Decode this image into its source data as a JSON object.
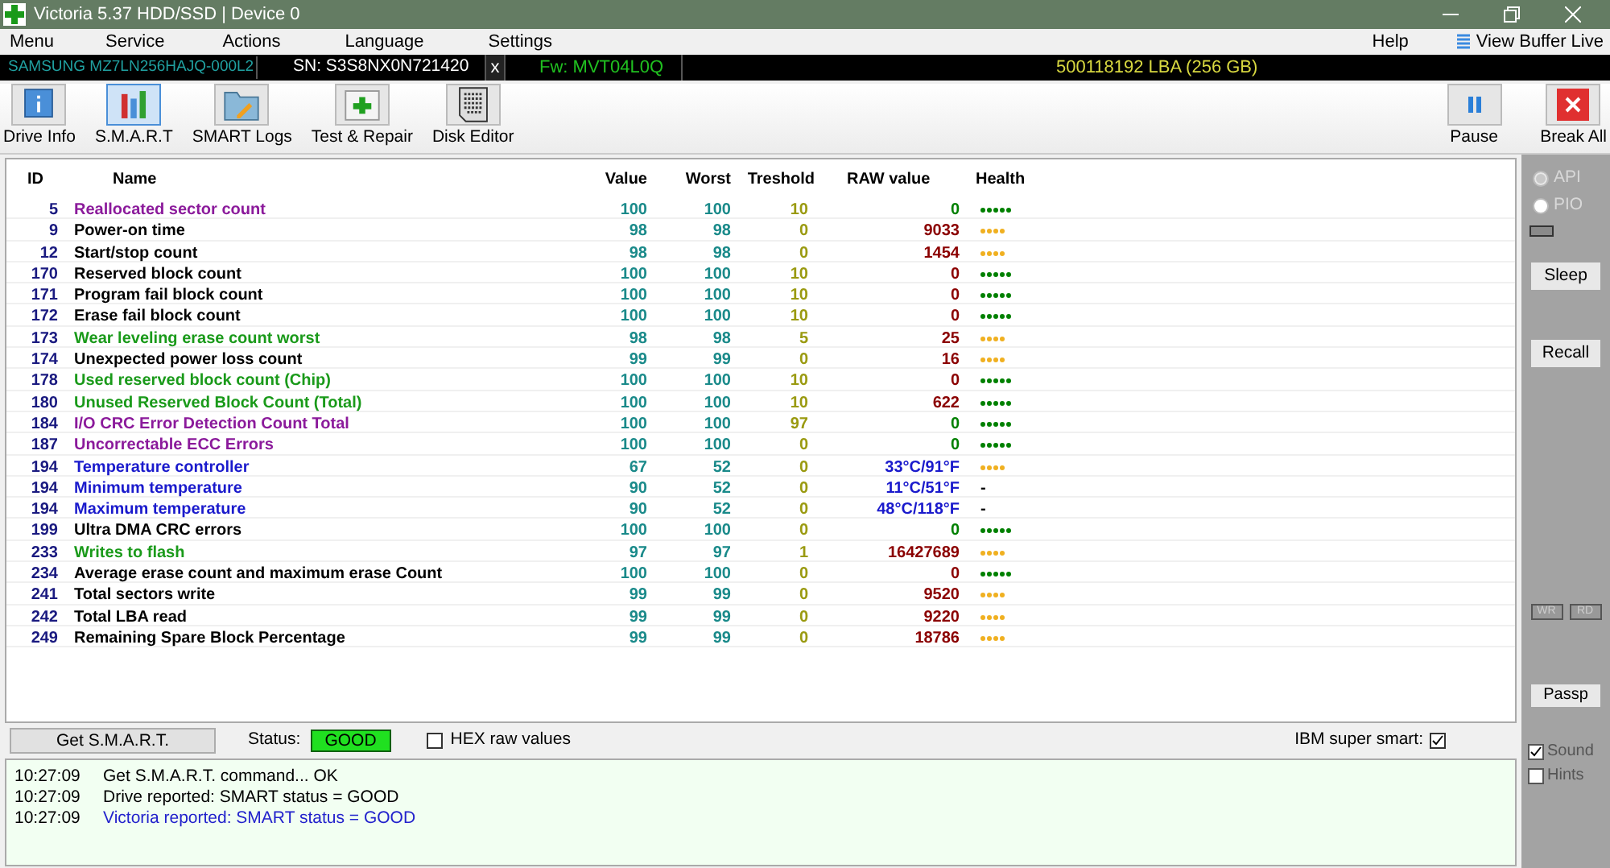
{
  "window": {
    "title": "Victoria 5.37 HDD/SSD | Device 0"
  },
  "menu": [
    {
      "label": "Menu"
    },
    {
      "label": "Service"
    },
    {
      "label": "Actions"
    },
    {
      "label": "Language"
    },
    {
      "label": "Settings"
    }
  ],
  "menu_right": {
    "help": "Help",
    "view_buffer": "View Buffer Live"
  },
  "device_bar": {
    "model": "SAMSUNG MZ7LN256HAJQ-000L2",
    "serial": "SN: S3S8NX0N721420",
    "close": "x",
    "firmware": "Fw: MVT04L0Q",
    "capacity": "500118192 LBA (256 GB)"
  },
  "toolbar": [
    {
      "label": "Drive Info",
      "kind": "info",
      "selected": false
    },
    {
      "label": "S.M.A.R.T",
      "kind": "smart",
      "selected": true
    },
    {
      "label": "SMART Logs",
      "kind": "logs",
      "selected": false
    },
    {
      "label": "Test & Repair",
      "kind": "test",
      "selected": false
    },
    {
      "label": "Disk Editor",
      "kind": "editor",
      "selected": false
    }
  ],
  "toolbar_right": [
    {
      "label": "Pause",
      "kind": "pause"
    },
    {
      "label": "Break All",
      "kind": "break"
    }
  ],
  "table": {
    "columns": [
      "ID",
      "Name",
      "Value",
      "Worst",
      "Treshold",
      "RAW value",
      "Health"
    ],
    "rows": [
      {
        "id": "5",
        "name": "Reallocated sector count",
        "color": "#8b1a9b",
        "value": "100",
        "worst": "100",
        "threshold": "10",
        "raw": {
          "text": "0",
          "color": "#008000"
        },
        "health": {
          "stars": 5,
          "color": "#008000"
        }
      },
      {
        "id": "9",
        "name": "Power-on time",
        "color": "#000000",
        "value": "98",
        "worst": "98",
        "threshold": "0",
        "raw": {
          "text": "9033",
          "color": "#8b0000"
        },
        "health": {
          "stars": 4,
          "color": "#f0b020"
        }
      },
      {
        "id": "12",
        "name": "Start/stop count",
        "color": "#000000",
        "value": "98",
        "worst": "98",
        "threshold": "0",
        "raw": {
          "text": "1454",
          "color": "#8b0000"
        },
        "health": {
          "stars": 4,
          "color": "#f0b020"
        }
      },
      {
        "id": "170",
        "name": "Reserved block count",
        "color": "#000000",
        "value": "100",
        "worst": "100",
        "threshold": "10",
        "raw": {
          "text": "0",
          "color": "#8b0000"
        },
        "health": {
          "stars": 5,
          "color": "#008000"
        }
      },
      {
        "id": "171",
        "name": "Program fail block count",
        "color": "#000000",
        "value": "100",
        "worst": "100",
        "threshold": "10",
        "raw": {
          "text": "0",
          "color": "#8b0000"
        },
        "health": {
          "stars": 5,
          "color": "#008000"
        }
      },
      {
        "id": "172",
        "name": "Erase fail block count",
        "color": "#000000",
        "value": "100",
        "worst": "100",
        "threshold": "10",
        "raw": {
          "text": "0",
          "color": "#8b0000"
        },
        "health": {
          "stars": 5,
          "color": "#008000"
        }
      },
      {
        "id": "173",
        "name": "Wear leveling erase count worst",
        "color": "#1a9a1a",
        "value": "98",
        "worst": "98",
        "threshold": "5",
        "raw": {
          "text": "25",
          "color": "#8b0000"
        },
        "health": {
          "stars": 4,
          "color": "#f0b020"
        }
      },
      {
        "id": "174",
        "name": "Unexpected power loss count",
        "color": "#000000",
        "value": "99",
        "worst": "99",
        "threshold": "0",
        "raw": {
          "text": "16",
          "color": "#8b0000"
        },
        "health": {
          "stars": 4,
          "color": "#f0b020"
        }
      },
      {
        "id": "178",
        "name": "Used reserved block count (Chip)",
        "color": "#1a9a1a",
        "value": "100",
        "worst": "100",
        "threshold": "10",
        "raw": {
          "text": "0",
          "color": "#8b0000"
        },
        "health": {
          "stars": 5,
          "color": "#008000"
        }
      },
      {
        "id": "180",
        "name": "Unused Reserved Block Count (Total)",
        "color": "#1a9a1a",
        "value": "100",
        "worst": "100",
        "threshold": "10",
        "raw": {
          "text": "622",
          "color": "#8b0000"
        },
        "health": {
          "stars": 5,
          "color": "#008000"
        }
      },
      {
        "id": "184",
        "name": "I/O CRC Error Detection Count Total",
        "color": "#8b1a9b",
        "value": "100",
        "worst": "100",
        "threshold": "97",
        "raw": {
          "text": "0",
          "color": "#008000"
        },
        "health": {
          "stars": 5,
          "color": "#008000"
        }
      },
      {
        "id": "187",
        "name": "Uncorrectable ECC Errors",
        "color": "#8b1a9b",
        "value": "100",
        "worst": "100",
        "threshold": "0",
        "raw": {
          "text": "0",
          "color": "#008000"
        },
        "health": {
          "stars": 5,
          "color": "#008000"
        }
      },
      {
        "id": "194",
        "name": "Temperature controller",
        "color": "#1a1acc",
        "value": "67",
        "worst": "52",
        "threshold": "0",
        "raw": {
          "text": "33°C/91°F",
          "color": "#1a1acc"
        },
        "health": {
          "stars": 4,
          "color": "#f0b020"
        }
      },
      {
        "id": "194",
        "name": "Minimum temperature",
        "color": "#1a1acc",
        "value": "90",
        "worst": "52",
        "threshold": "0",
        "raw": {
          "text": "11°C/51°F",
          "color": "#1a1acc"
        },
        "health": {
          "text": "-"
        }
      },
      {
        "id": "194",
        "name": "Maximum temperature",
        "color": "#1a1acc",
        "value": "90",
        "worst": "52",
        "threshold": "0",
        "raw": {
          "text": "48°C/118°F",
          "color": "#1a1acc"
        },
        "health": {
          "text": "-"
        }
      },
      {
        "id": "199",
        "name": "Ultra DMA CRC errors",
        "color": "#000000",
        "value": "100",
        "worst": "100",
        "threshold": "0",
        "raw": {
          "text": "0",
          "color": "#008000"
        },
        "health": {
          "stars": 5,
          "color": "#008000"
        }
      },
      {
        "id": "233",
        "name": "Writes to flash",
        "color": "#1a9a1a",
        "value": "97",
        "worst": "97",
        "threshold": "1",
        "raw": {
          "text": "16427689",
          "color": "#8b0000"
        },
        "health": {
          "stars": 4,
          "color": "#f0b020"
        }
      },
      {
        "id": "234",
        "name": "Average erase count and maximum erase Count",
        "color": "#000000",
        "value": "100",
        "worst": "100",
        "threshold": "0",
        "raw": {
          "text": "0",
          "color": "#8b0000"
        },
        "health": {
          "stars": 5,
          "color": "#008000"
        }
      },
      {
        "id": "241",
        "name": "Total sectors write",
        "color": "#000000",
        "value": "99",
        "worst": "99",
        "threshold": "0",
        "raw": {
          "text": "9520",
          "color": "#8b0000"
        },
        "health": {
          "stars": 4,
          "color": "#f0b020"
        }
      },
      {
        "id": "242",
        "name": "Total LBA read",
        "color": "#000000",
        "value": "99",
        "worst": "99",
        "threshold": "0",
        "raw": {
          "text": "9220",
          "color": "#8b0000"
        },
        "health": {
          "stars": 4,
          "color": "#f0b020"
        }
      },
      {
        "id": "249",
        "name": "Remaining Spare Block Percentage",
        "color": "#000000",
        "value": "99",
        "worst": "99",
        "threshold": "0",
        "raw": {
          "text": "18786",
          "color": "#8b0000"
        },
        "health": {
          "stars": 4,
          "color": "#f0b020"
        }
      }
    ]
  },
  "bottom_bar": {
    "get_smart": "Get S.M.A.R.T.",
    "status_label": "Status:",
    "status": "GOOD",
    "hex_label": "HEX raw values",
    "hex_checked": false,
    "ibm_label": "IBM super smart:",
    "ibm_checked": true
  },
  "log": [
    {
      "time": "10:27:09",
      "message": "Get S.M.A.R.T. command... OK",
      "color": "#000000"
    },
    {
      "time": "10:27:09",
      "message": "Drive reported: SMART status = GOOD",
      "color": "#000000"
    },
    {
      "time": "10:27:09",
      "message": "Victoria reported: SMART status = GOOD",
      "color": "#2222cc"
    }
  ],
  "side_panel": {
    "modes": [
      {
        "label": "API",
        "selected": true
      },
      {
        "label": "PIO",
        "selected": false
      }
    ],
    "sleep": "Sleep",
    "recall": "Recall",
    "wr": "WR",
    "rd": "RD",
    "passp": "Passp",
    "options": [
      {
        "label": "Sound",
        "checked": true
      },
      {
        "label": "Hints",
        "checked": false
      }
    ]
  }
}
